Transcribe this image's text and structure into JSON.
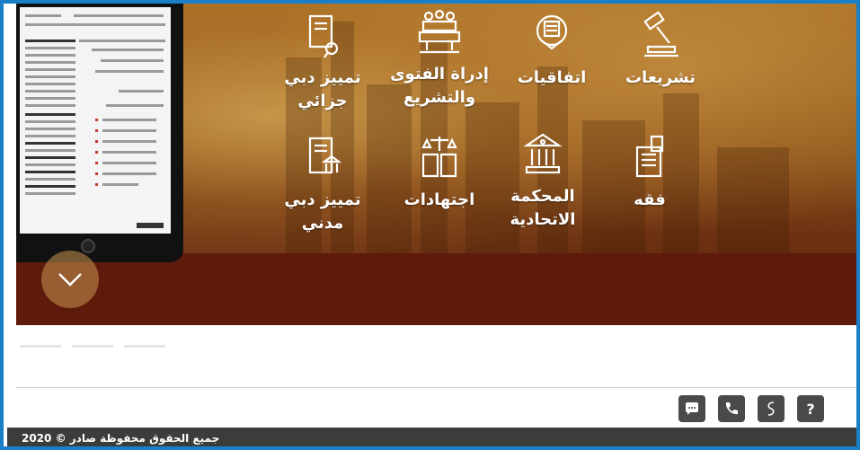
{
  "tiles": [
    {
      "label": "تشريعات",
      "icon": "gavel-icon"
    },
    {
      "label": "اتفاقيات",
      "icon": "agreement-icon"
    },
    {
      "label": "إدراة الفتوى\nوالتشريع",
      "icon": "building-icon"
    },
    {
      "label": "تمييز دبي\nجزائي",
      "icon": "criminal-doc-icon"
    },
    {
      "label": "فقه",
      "icon": "jurisprudence-icon"
    },
    {
      "label": "المحكمة الاتحادية",
      "icon": "court-icon"
    },
    {
      "label": "اجتهادات",
      "icon": "scales-book-icon"
    },
    {
      "label": "تمييز دبي\nمدني",
      "icon": "civil-doc-icon"
    }
  ],
  "help_icons": [
    "help-icon",
    "logo-icon",
    "phone-icon",
    "chat-icon"
  ],
  "footer": {
    "copyright": "جميع الحقوق محفوظة صادر © 2020"
  },
  "colors": {
    "frame": "#1a7fc7",
    "band": "#5e1a0b",
    "footer": "#3c3c3c",
    "icon_bg": "#4a4a4a"
  }
}
